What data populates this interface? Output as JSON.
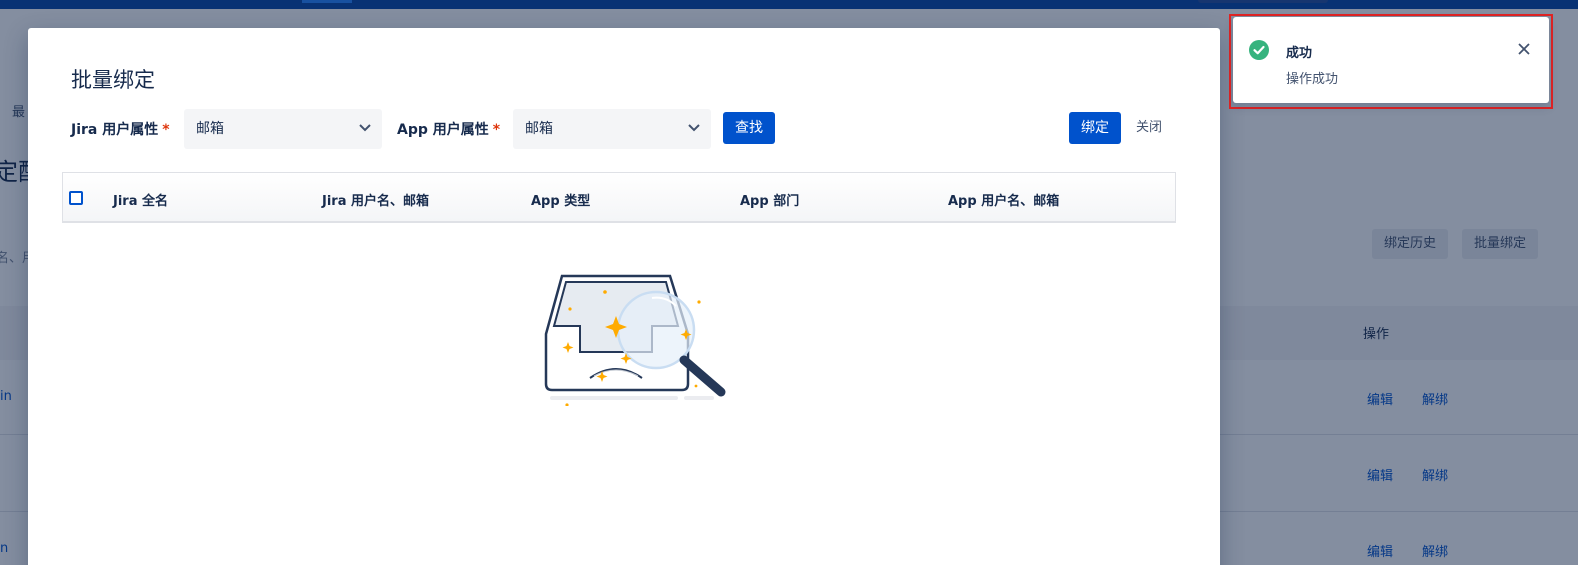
{
  "background": {
    "nav_item": "最",
    "page_title": "定配",
    "search_hint": "名、用",
    "buttons": {
      "history": "绑定历史",
      "batch_bind": "批量绑定"
    },
    "table": {
      "operation_col": "操作",
      "rows": [
        {
          "edit": "编辑",
          "unbind": "解绑",
          "stub": "in"
        },
        {
          "edit": "编辑",
          "unbind": "解绑",
          "stub": ""
        },
        {
          "edit": "编辑",
          "unbind": "解绑",
          "stub": "n"
        }
      ]
    }
  },
  "modal": {
    "title": "批量绑定",
    "jira_attr": {
      "label": "Jira 用户属性",
      "value": "邮箱"
    },
    "app_attr": {
      "label": "App 用户属性",
      "value": "邮箱"
    },
    "required_mark": "*",
    "search_button": "查找",
    "bind_button": "绑定",
    "close_button": "关闭",
    "table_headers": [
      "Jira 全名",
      "Jira 用户名、邮箱",
      "App 类型",
      "App 部门",
      "App 用户名、邮箱"
    ],
    "empty_icon": "empty-box-magnifier-icon"
  },
  "toast": {
    "title": "成功",
    "message": "操作成功",
    "icon": "check-circle-icon",
    "accent": "#36b37e"
  },
  "colors": {
    "primary": "#0052cc",
    "topbar": "#0747a6",
    "required": "#de350b",
    "highlight": "#e02424"
  }
}
